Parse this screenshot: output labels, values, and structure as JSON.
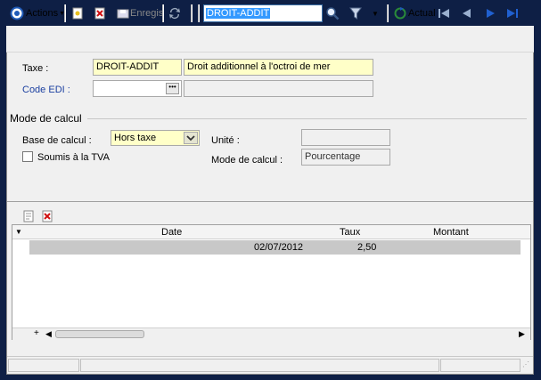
{
  "toolbar": {
    "actions_label": "Actions",
    "save_label": "Enregis",
    "search_value": "DROIT-ADDIT",
    "refresh_label": "Actual"
  },
  "form": {
    "taxe_label": "Taxe :",
    "taxe_code": "DROIT-ADDIT",
    "taxe_description": "Droit additionnel à l'octroi de mer",
    "code_edi_label": "Code EDI :",
    "code_edi_value": "",
    "code_edi_desc": ""
  },
  "mode_calcul": {
    "section_title": "Mode de calcul",
    "base_label": "Base de calcul :",
    "base_value": "Hors taxe",
    "unite_label": "Unité :",
    "unite_value": "",
    "mode_label": "Mode de calcul :",
    "mode_value": "Pourcentage",
    "tva_label": "Soumis à la TVA"
  },
  "grid": {
    "columns": [
      "Date",
      "Taux",
      "Montant"
    ],
    "rows": [
      {
        "date": "02/07/2012",
        "taux": "2,50",
        "montant": ""
      }
    ],
    "footer_plus": "+"
  },
  "colors": {
    "field_yellow": "#ffffc8",
    "selection_blue": "#3399ff",
    "label_blue": "#1a3fa0"
  }
}
